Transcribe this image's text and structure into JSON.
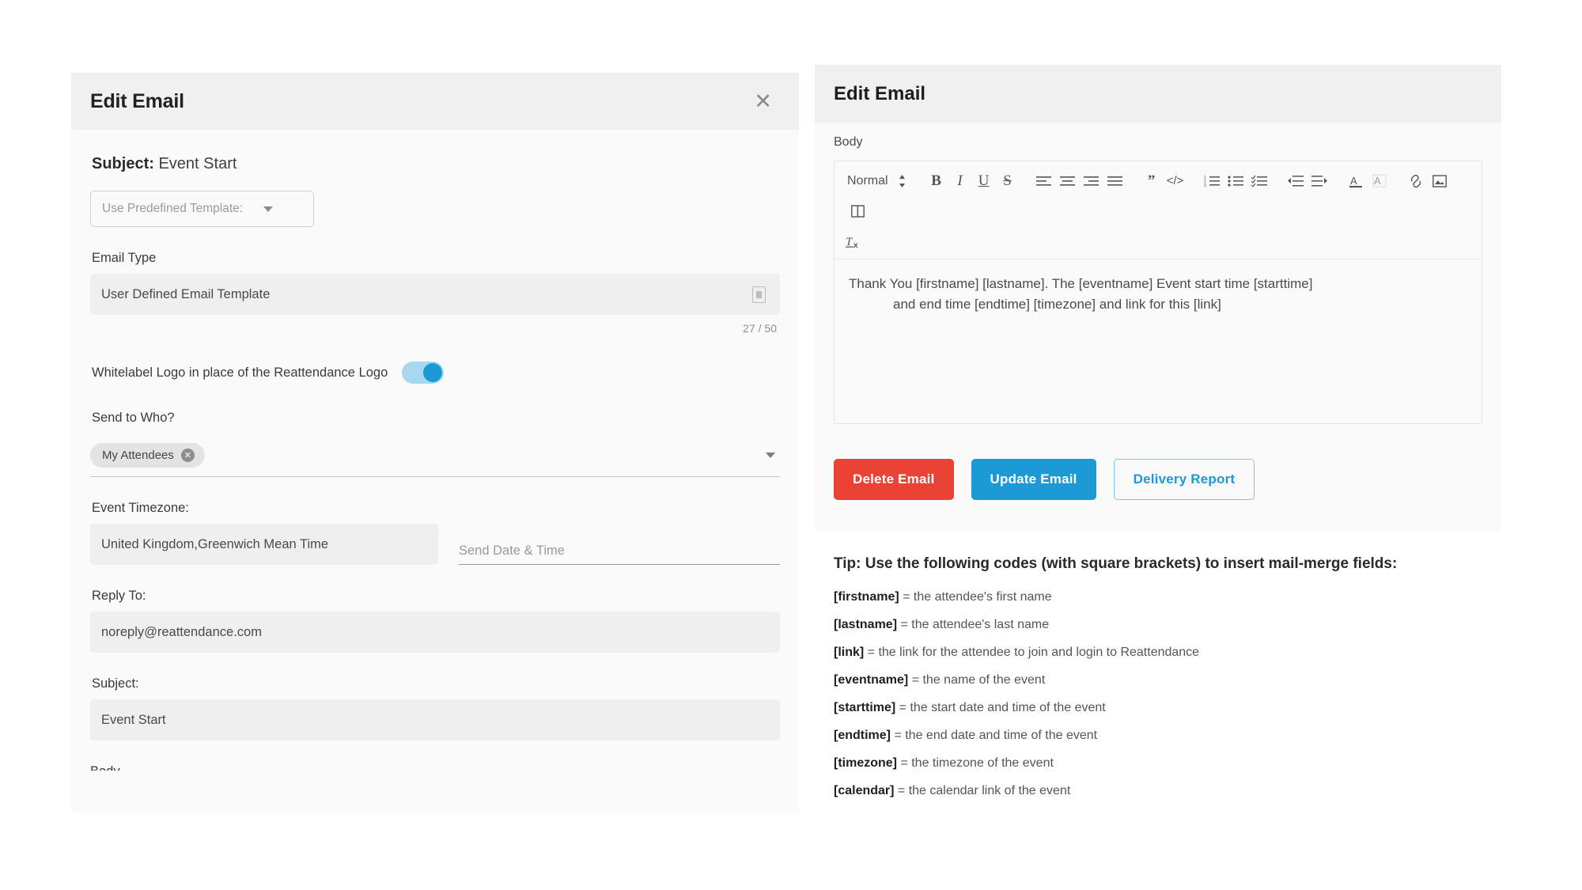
{
  "left_panel": {
    "title": "Edit Email",
    "close_icon": "close-icon",
    "subject_prefix": "Subject:",
    "subject_value": "Event Start",
    "template_select": {
      "placeholder": "Use Predefined Template:",
      "icon": "chevron-down-icon"
    },
    "email_type": {
      "label": "Email Type",
      "value": "User Defined Email Template",
      "trailing_icon": "document-icon",
      "counter": "27 / 50"
    },
    "whitelabel": {
      "label": "Whitelabel Logo in place of the Reattendance Logo",
      "state": "on"
    },
    "send_to_who": {
      "label": "Send to Who?",
      "chips": [
        "My Attendees"
      ],
      "chip_remove_icon": "close-circle-icon",
      "dropdown_icon": "chevron-down-icon"
    },
    "event_timezone": {
      "label": "Event Timezone:",
      "value": "United Kingdom,Greenwich Mean Time"
    },
    "send_date_time": {
      "placeholder": "Send Date & Time",
      "value": ""
    },
    "reply_to": {
      "label": "Reply To:",
      "value": "noreply@reattendance.com"
    },
    "subject": {
      "label": "Subject:",
      "value": "Event Start"
    },
    "cut_off_label": "Body"
  },
  "right_panel": {
    "title": "Edit Email",
    "body_label": "Body",
    "toolbar": {
      "format_select": "Normal",
      "items": [
        {
          "name": "format-select",
          "label": "Normal"
        },
        {
          "name": "format-stepper-icon",
          "label": "↕"
        },
        {
          "name": "bold-icon",
          "label": "B"
        },
        {
          "name": "italic-icon",
          "label": "I"
        },
        {
          "name": "underline-icon",
          "label": "U"
        },
        {
          "name": "strikethrough-icon",
          "label": "S"
        },
        {
          "name": "align-left-icon",
          "label": ""
        },
        {
          "name": "align-center-icon",
          "label": ""
        },
        {
          "name": "align-right-icon",
          "label": ""
        },
        {
          "name": "align-justify-icon",
          "label": ""
        },
        {
          "name": "blockquote-icon",
          "label": "”"
        },
        {
          "name": "code-block-icon",
          "label": "</>"
        },
        {
          "name": "ordered-list-icon",
          "label": ""
        },
        {
          "name": "bullet-list-icon",
          "label": ""
        },
        {
          "name": "check-list-icon",
          "label": ""
        },
        {
          "name": "outdent-icon",
          "label": ""
        },
        {
          "name": "indent-icon",
          "label": ""
        },
        {
          "name": "text-color-icon",
          "label": "A"
        },
        {
          "name": "background-color-icon",
          "label": "A"
        },
        {
          "name": "link-icon",
          "label": ""
        },
        {
          "name": "image-icon",
          "label": ""
        },
        {
          "name": "video-icon",
          "label": ""
        },
        {
          "name": "clear-formatting-icon",
          "label": "Tx"
        }
      ]
    },
    "editor_content": {
      "line1": "Thank You [firstname] [lastname]. The [eventname] Event start time [starttime]",
      "line2": "and end time [endtime] [timezone] and link for this [link]"
    },
    "buttons": {
      "delete": "Delete Email",
      "update": "Update Email",
      "report": "Delivery Report"
    }
  },
  "tip": {
    "title": "Tip: Use the following codes (with square brackets) to insert mail-merge fields:",
    "rows": [
      {
        "code": "[firstname]",
        "desc": " = the attendee's first name"
      },
      {
        "code": "[lastname]",
        "desc": " = the attendee's last name"
      },
      {
        "code": "[link]",
        "desc": " = the link for the attendee to join and login to Reattendance"
      },
      {
        "code": "[eventname]",
        "desc": " = the name of the event"
      },
      {
        "code": "[starttime]",
        "desc": " = the start date and time of the event"
      },
      {
        "code": "[endtime]",
        "desc": " = the end date and time of the event"
      },
      {
        "code": "[timezone]",
        "desc": " = the timezone of the event"
      },
      {
        "code": "[calendar]",
        "desc": " = the calendar link of the event"
      }
    ]
  },
  "colors": {
    "danger": "#ea4335",
    "primary": "#1b9ad6",
    "toggle_track": "#a8d8f0",
    "panel_header": "#f0f0f0",
    "panel_bg": "#fafafa"
  }
}
